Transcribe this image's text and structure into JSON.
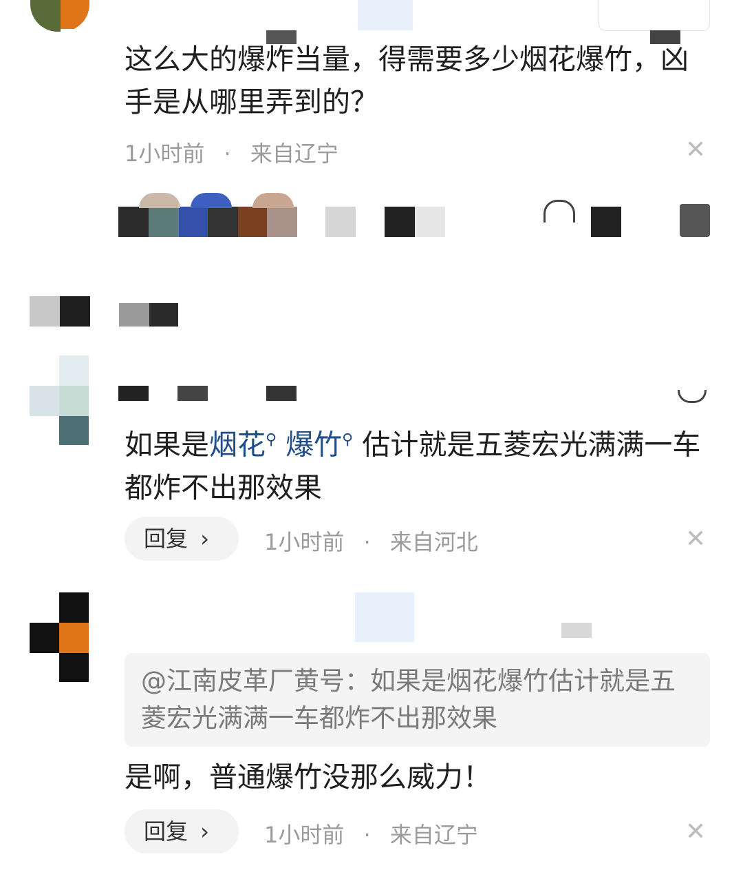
{
  "comments": [
    {
      "text": "这么大的爆炸当量，得需要多少烟花爆竹，凶手是从哪里弄到的？",
      "time": "1小时前",
      "dot": "·",
      "location": "来自辽宁",
      "close_icon": "✕"
    },
    {
      "text_prefix": "如果是",
      "link1": "烟花",
      "link2": "爆竹",
      "search_icon": "⚲",
      "text_suffix": "估计就是五菱宏光满满一车都炸不出那效果",
      "reply_label": "回复",
      "reply_chevron": "›",
      "time": "1小时前",
      "dot": "·",
      "location": "来自河北",
      "close_icon": "✕"
    },
    {
      "quote": "@江南皮革厂黄号：如果是烟花爆竹估计就是五菱宏光满满一车都炸不出那效果",
      "text": "是啊，普通爆竹没那么威力！",
      "reply_label": "回复",
      "reply_chevron": "›",
      "time": "1小时前",
      "dot": "·",
      "location": "来自辽宁",
      "close_icon": "✕"
    }
  ],
  "colors": {
    "link": "#1f4e8a",
    "meta": "#9a9a9a",
    "reply_bg": "#f3f3f3",
    "quote_bg": "#f4f4f4"
  }
}
